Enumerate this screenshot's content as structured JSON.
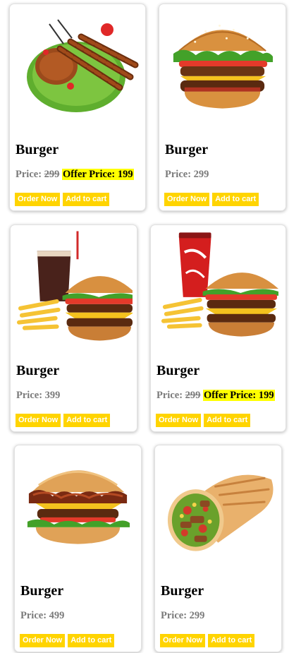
{
  "products": [
    {
      "title": "Burger",
      "price_label": "Price:",
      "price": "299",
      "offer_label": "Offer Price:",
      "offer_price": "199",
      "order_label": "Order Now",
      "cart_label": "Add to cart",
      "image": "grilled-kebab-platter"
    },
    {
      "title": "Burger",
      "price_label": "Price:",
      "price": "299",
      "order_label": "Order Now",
      "cart_label": "Add to cart",
      "image": "double-cheeseburger"
    },
    {
      "title": "Burger",
      "price_label": "Price:",
      "price": "399",
      "order_label": "Order Now",
      "cart_label": "Add to cart",
      "image": "burger-fries-cola-glass"
    },
    {
      "title": "Burger",
      "price_label": "Price:",
      "price": "299",
      "offer_label": "Offer Price:",
      "offer_price": "199",
      "order_label": "Order Now",
      "cart_label": "Add to cart",
      "image": "burger-fries-coca-cola-cup"
    },
    {
      "title": "Burger",
      "price_label": "Price:",
      "price": "499",
      "order_label": "Order Now",
      "cart_label": "Add to cart",
      "image": "bacon-cheeseburger"
    },
    {
      "title": "Burger",
      "price_label": "Price:",
      "price": "299",
      "order_label": "Order Now",
      "cart_label": "Add to cart",
      "image": "wrap-roll"
    }
  ],
  "colors": {
    "button_bg": "#ffd400",
    "button_text": "#ffffff",
    "offer_highlight": "#ffff00",
    "price_text": "#7a7a7a"
  }
}
